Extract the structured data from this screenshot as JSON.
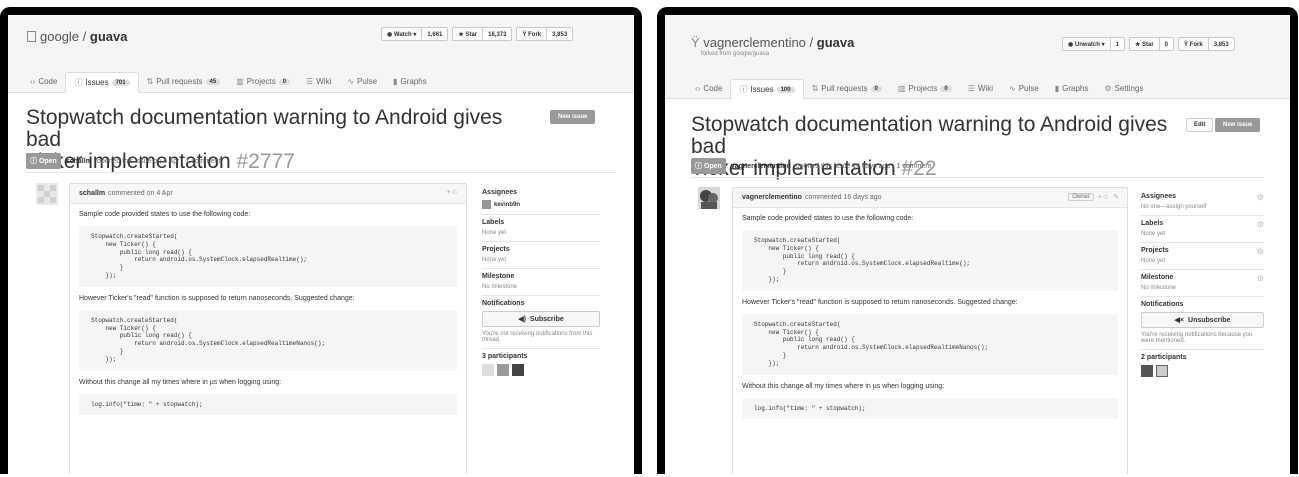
{
  "left": {
    "repo_owner": "google",
    "repo_sep": " / ",
    "repo_name": "guava",
    "watch_label": "Watch ▾",
    "watch_count": "1,661",
    "star_label": "Star",
    "star_count": "16,373",
    "fork_label": "Fork",
    "fork_count": "3,853",
    "tabs": [
      {
        "label": "Code",
        "icon": "‹›",
        "count": ""
      },
      {
        "label": "Issues",
        "icon": "ⓘ",
        "count": "701"
      },
      {
        "label": "Pull requests",
        "icon": "⇅",
        "count": "45"
      },
      {
        "label": "Projects",
        "icon": "▥",
        "count": "0"
      },
      {
        "label": "Wiki",
        "icon": "☰",
        "count": ""
      },
      {
        "label": "Pulse",
        "icon": "∿",
        "count": ""
      },
      {
        "label": "Graphs",
        "icon": "▮",
        "count": ""
      }
    ],
    "title_line1": "Stopwatch documentation warning to Android gives bad",
    "title_line2": "Ticker implementation",
    "issue_number": "#2777",
    "new_issue": "New issue",
    "state": "ⓘ Open",
    "author": "schallm",
    "meta_text": "opened this issue on 4 Apr · 1 comment",
    "comment_author": "schallm",
    "comment_meta": "commented on 4 Apr",
    "sidebar": {
      "assignees_title": "Assignees",
      "assignee": "kevinb9n",
      "labels_title": "Labels",
      "labels_value": "None yet",
      "projects_title": "Projects",
      "projects_value": "None yet",
      "milestone_title": "Milestone",
      "milestone_value": "No milestone",
      "notifications_title": "Notifications",
      "subscribe_label": "Subscribe",
      "notify_text": "You're not receiving notifications from this thread.",
      "participants_title": "3 participants"
    }
  },
  "right": {
    "repo_owner": "vagnerclementino",
    "repo_sep": " / ",
    "repo_name": "guava",
    "forked_from": "forked from google/guava",
    "watch_label": "Unwatch ▾",
    "watch_count": "1",
    "star_label": "Star",
    "star_count": "0",
    "fork_label": "Fork",
    "fork_count": "3,853",
    "tabs": [
      {
        "label": "Code",
        "icon": "‹›",
        "count": ""
      },
      {
        "label": "Issues",
        "icon": "ⓘ",
        "count": "100"
      },
      {
        "label": "Pull requests",
        "icon": "⇅",
        "count": "0"
      },
      {
        "label": "Projects",
        "icon": "▥",
        "count": "0"
      },
      {
        "label": "Wiki",
        "icon": "☰",
        "count": ""
      },
      {
        "label": "Pulse",
        "icon": "∿",
        "count": ""
      },
      {
        "label": "Graphs",
        "icon": "▮",
        "count": ""
      },
      {
        "label": "Settings",
        "icon": "⚙",
        "count": ""
      }
    ],
    "title_line1": "Stopwatch documentation warning to Android gives bad",
    "title_line2": "Ticker implementation",
    "issue_number": "#22",
    "edit": "Edit",
    "new_issue": "New issue",
    "state": "ⓘ Open",
    "author": "vagnerclementino",
    "meta_text": "opened this issue 16 days ago · 1 comment",
    "comment_author": "vagnerclementino",
    "comment_meta": "commented 16 days ago",
    "owner_badge": "Owner",
    "sidebar": {
      "assignees_title": "Assignees",
      "assignees_value": "No one—assign yourself",
      "labels_title": "Labels",
      "labels_value": "None yet",
      "projects_title": "Projects",
      "projects_value": "None yet",
      "milestone_title": "Milestone",
      "milestone_value": "No milestone",
      "notifications_title": "Notifications",
      "subscribe_label": "Unsubscribe",
      "notify_text": "You're receiving notifications because you were mentioned.",
      "participants_title": "2 participants"
    }
  },
  "body": {
    "p1": "Sample code provided states to use the following code:",
    "code1": [
      "Stopwatch.createStarted(",
      "    new Ticker() {",
      "        public long read() {",
      "            return android.os.SystemClock.elapsedRealtime();",
      "        }",
      "    });"
    ],
    "p2": "However Ticker's \"read\" function is supposed to return nanoseconds. Suggested change:",
    "code2": [
      "Stopwatch.createStarted(",
      "    new Ticker() {",
      "        public long read() {",
      "            return android.os.SystemClock.elapsedRealtimeNanos();",
      "        }",
      "    });"
    ],
    "p3": "Without this change all my times where in µs when logging using:",
    "code3": "log.info(\"time: \" + stopwatch);"
  }
}
